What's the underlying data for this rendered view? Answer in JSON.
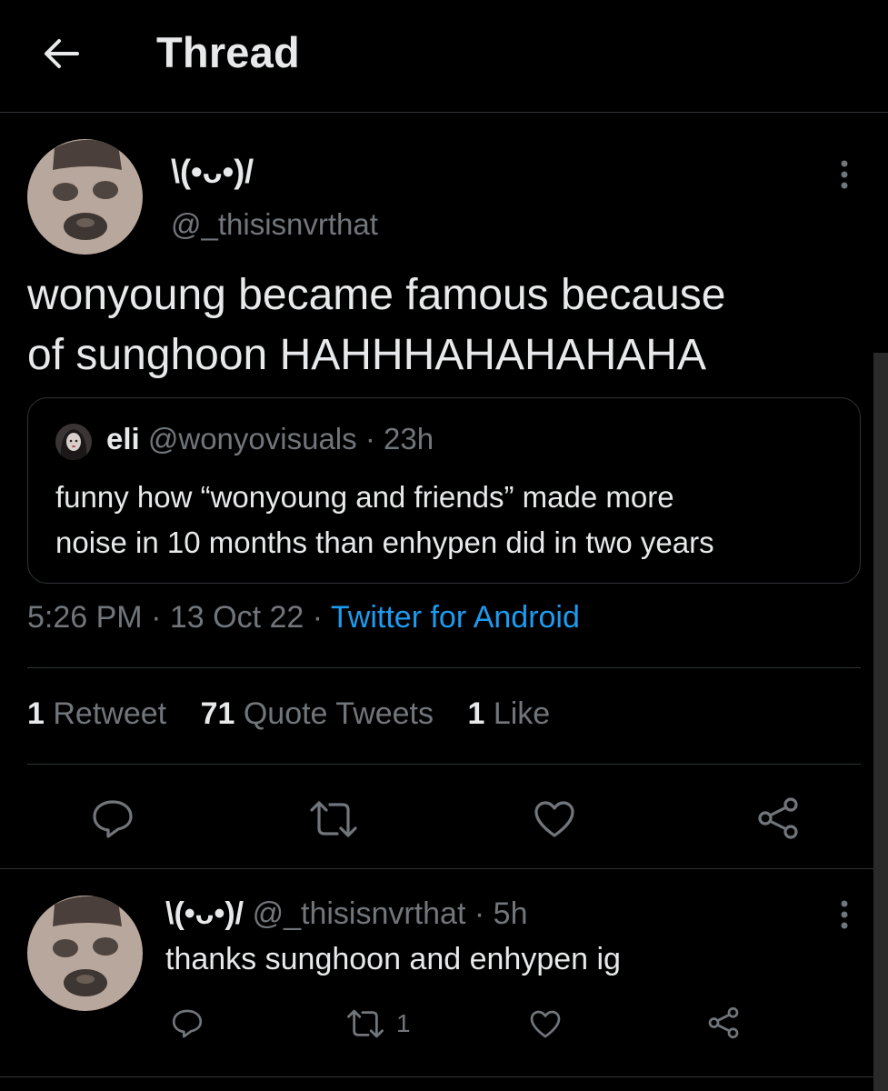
{
  "header": {
    "title": "Thread"
  },
  "main_tweet": {
    "display_name": "\\(•ᴗ•)/",
    "handle": "@_thisisnvrthat",
    "text_line1": "wonyoung became famous because",
    "text_line2": "of sunghoon HAHHHAHAHAHAHA",
    "quoted": {
      "name": "eli",
      "handle": "@wonyovisuals",
      "time": "23h",
      "text_line1": "funny how “wonyoung and friends” made more",
      "text_line2": "noise in 10 months than enhypen did in two years"
    },
    "time": "5:26 PM",
    "date": "13 Oct 22",
    "source": "Twitter for Android",
    "stats": {
      "retweets": "1",
      "retweets_label": "Retweet",
      "quotes": "71",
      "quotes_label": "Quote Tweets",
      "likes": "1",
      "likes_label": "Like"
    }
  },
  "reply": {
    "display_name": "\\(•ᴗ•)/",
    "handle": "@_thisisnvrthat",
    "time": "5h",
    "text": "thanks sunghoon and enhypen ig",
    "retweet_count": "1"
  },
  "icons": {
    "back": "arrow-left-icon",
    "more": "more-vertical-icon",
    "reply": "comment-icon",
    "retweet": "retweet-icon",
    "like": "heart-icon",
    "share": "share-icon"
  },
  "colors": {
    "background": "#000000",
    "text_primary": "#e7e9ea",
    "text_secondary": "#71767b",
    "accent": "#1d9bf0",
    "border": "#2f3336"
  }
}
